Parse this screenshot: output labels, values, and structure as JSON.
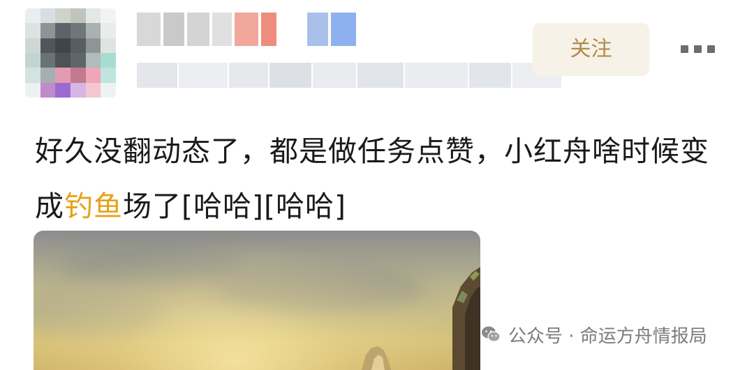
{
  "header": {
    "follow_label": "关注",
    "more_icon": "more-horizontal-icon"
  },
  "post": {
    "text_before": "好久没翻动态了，都是做任务点赞，小红舟啥时候变成",
    "highlight": "钓鱼",
    "text_after": "场了[哈哈][哈哈]"
  },
  "watermark": {
    "icon": "wechat-icon",
    "text": "公众号 · 命运方舟情报局"
  },
  "colors": {
    "highlight": "#e4a21a",
    "follow_text": "#b18a4a",
    "follow_bg": "#f7f2e8"
  }
}
